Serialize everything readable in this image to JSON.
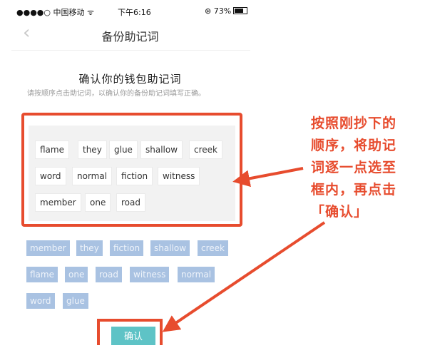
{
  "status_bar": {
    "carrier": "●●●●○ 中国移动 ᯤ",
    "time": "下午6:16",
    "battery": "⊛ 73%"
  },
  "nav": {
    "back_icon": "chevron-left-icon",
    "title": "备份助记词"
  },
  "heading": "确认你的钱包助记词",
  "instruction": "请按顺序点击助记词，以确认你的备份助记词填写正确。",
  "selected_words": [
    "flame",
    "they",
    "glue",
    "shallow",
    "creek",
    "word",
    "normal",
    "fiction",
    "witness",
    "member",
    "one",
    "road"
  ],
  "pool_words": [
    "member",
    "they",
    "fiction",
    "shallow",
    "creek",
    "flame",
    "one",
    "road",
    "witness",
    "normal",
    "word",
    "glue"
  ],
  "confirm_button": "确认",
  "annotation": {
    "lines": [
      "按照刚抄下的",
      "顺序，将助记",
      "词逐一点选至",
      "框内，再点击",
      "「确认」"
    ],
    "color": "#e74c2e"
  },
  "colors": {
    "highlight": "#e74c2e",
    "chip_pool": "#a9c2e2",
    "confirm": "#5ec3c6"
  }
}
